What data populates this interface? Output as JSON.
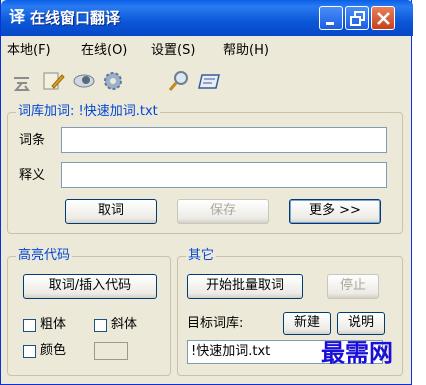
{
  "window": {
    "title": "在线窗口翻译",
    "title_icon_glyph": "译"
  },
  "menu": {
    "items": [
      "本地(F)",
      "在线(O)",
      "设置(S)",
      "帮助(H)"
    ]
  },
  "toolbar": {
    "icons": [
      "cloud-icon",
      "edit-page-icon",
      "eye-icon",
      "gear-icon",
      "magnifier-icon",
      "card-icon"
    ]
  },
  "dict_group": {
    "title": "词库加词: !快速加词.txt",
    "entry_label": "词条",
    "entry_value": "",
    "meaning_label": "释义",
    "meaning_value": "",
    "fetch_button": "取词",
    "save_button": "保存",
    "more_button": "更多 >>"
  },
  "highlight_group": {
    "title": "高亮代码",
    "insert_button": "取词/插入代码",
    "bold_label": "粗体",
    "italic_label": "斜体",
    "color_label": "颜色"
  },
  "other_group": {
    "title": "其它",
    "batch_button": "开始批量取词",
    "stop_button": "停止",
    "target_label": "目标词库:",
    "new_button": "新建",
    "help_button": "说明",
    "target_value": "!快速加词.txt"
  },
  "watermark": "最需网",
  "colors": {
    "titlebar": "#0b57d8",
    "window_bg": "#ece9d8",
    "group_title": "#0046d5",
    "watermark": "#1a0fd8"
  }
}
